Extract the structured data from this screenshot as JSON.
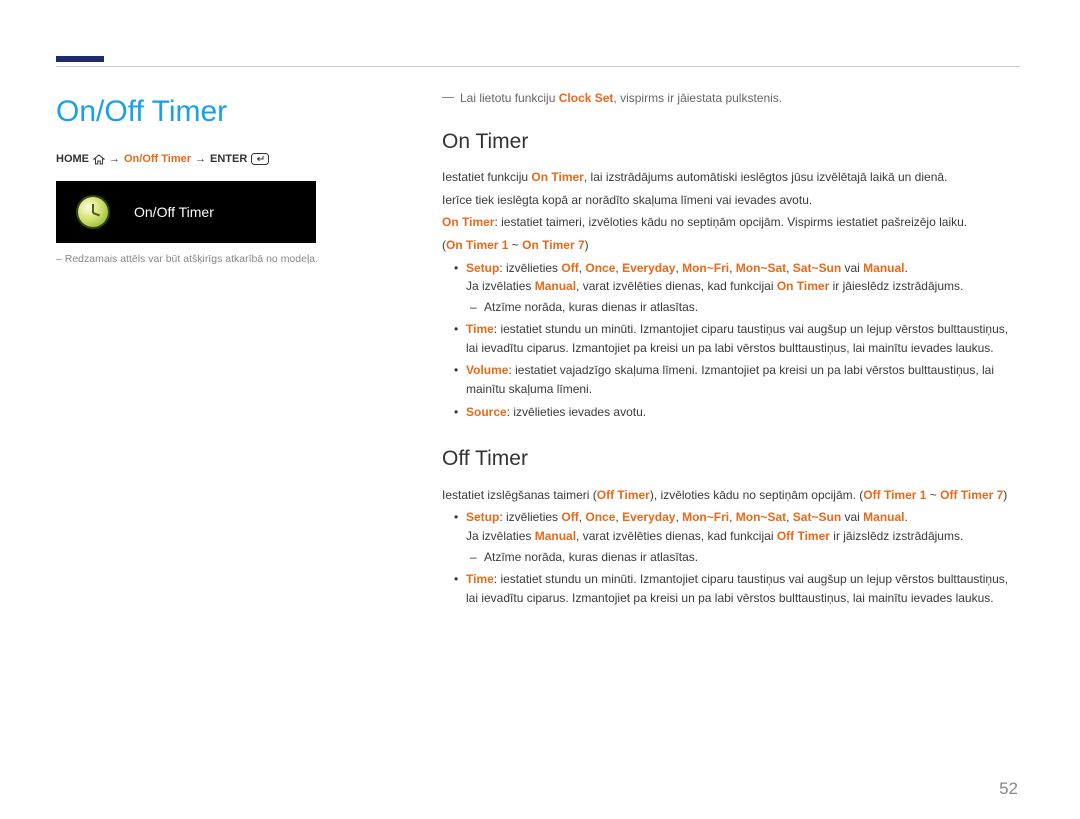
{
  "page_number": "52",
  "left": {
    "title": "On/Off Timer",
    "breadcrumb_home": "HOME",
    "breadcrumb_item": "On/Off Timer",
    "breadcrumb_enter": "ENTER",
    "screenshot_label": "On/Off Timer",
    "caption": "– Redzamais attēls var būt atšķirīgs atkarībā no modeļa."
  },
  "right": {
    "top_note_a": "Lai lietotu funkciju ",
    "top_note_b": "Clock Set",
    "top_note_c": ", vispirms ir jāiestata pulkstenis.",
    "on_timer": {
      "heading": "On Timer",
      "p1a": "Iestatiet funkciju ",
      "p1b": "On Timer",
      "p1c": ", lai izstrādājums automātiski ieslēgtos jūsu izvēlētajā laikā un dienā.",
      "p2": "Ierīce tiek ieslēgta kopā ar norādīto skaļuma līmeni vai ievades avotu.",
      "p3a": "On Timer",
      "p3b": ": iestatiet taimeri, izvēloties kādu no septiņām opcijām. Vispirms iestatiet pašreizējo laiku.",
      "p4": "(",
      "p4b": "On Timer 1",
      "p4c": " ~ ",
      "p4d": "On Timer 7",
      "p4e": ")",
      "li1_setup": "Setup",
      "li1_mid": ": izvēlieties ",
      "li1_off": "Off",
      "c": ", ",
      "li1_once": "Once",
      "li1_every": "Everyday",
      "li1_monfri": "Mon~Fri",
      "li1_monsat": "Mon~Sat",
      "li1_satsun": "Sat~Sun",
      "li1_vai": " vai ",
      "li1_manual": "Manual",
      "dot": ".",
      "li1b_a": "Ja izvēlaties ",
      "li1b_b": "Manual",
      "li1b_c": ", varat izvēlēties dienas, kad funkcijai ",
      "li1b_d": "On Timer",
      "li1b_e": " ir jāieslēdz izstrādājums.",
      "li1c": "Atzīme norāda, kuras dienas ir atlasītas.",
      "li2_time": "Time",
      "li2_body": ": iestatiet stundu un minūti. Izmantojiet ciparu taustiņus vai augšup un lejup vērstos bulttaustiņus, lai ievadītu ciparus. Izmantojiet pa kreisi un pa labi vērstos bulttaustiņus, lai mainītu ievades laukus.",
      "li3_vol": "Volume",
      "li3_body": ": iestatiet vajadzīgo skaļuma līmeni. Izmantojiet pa kreisi un pa labi vērstos bulttaustiņus, lai mainītu skaļuma līmeni.",
      "li4_src": "Source",
      "li4_body": ": izvēlieties ievades avotu."
    },
    "off_timer": {
      "heading": "Off Timer",
      "p1a": "Iestatiet izslēgšanas taimeri (",
      "p1b": "Off Timer",
      "p1c": "), izvēloties kādu no septiņām opcijām. (",
      "p1d": "Off Timer 1",
      "p1e": " ~ ",
      "p1f": "Off Timer 7",
      "p1g": ")",
      "li1b_a": "Ja izvēlaties ",
      "li1b_b": "Manual",
      "li1b_c": ", varat izvēlēties dienas, kad funkcijai ",
      "li1b_d": "Off Timer",
      "li1b_e": " ir jāizslēdz izstrādājums."
    }
  }
}
